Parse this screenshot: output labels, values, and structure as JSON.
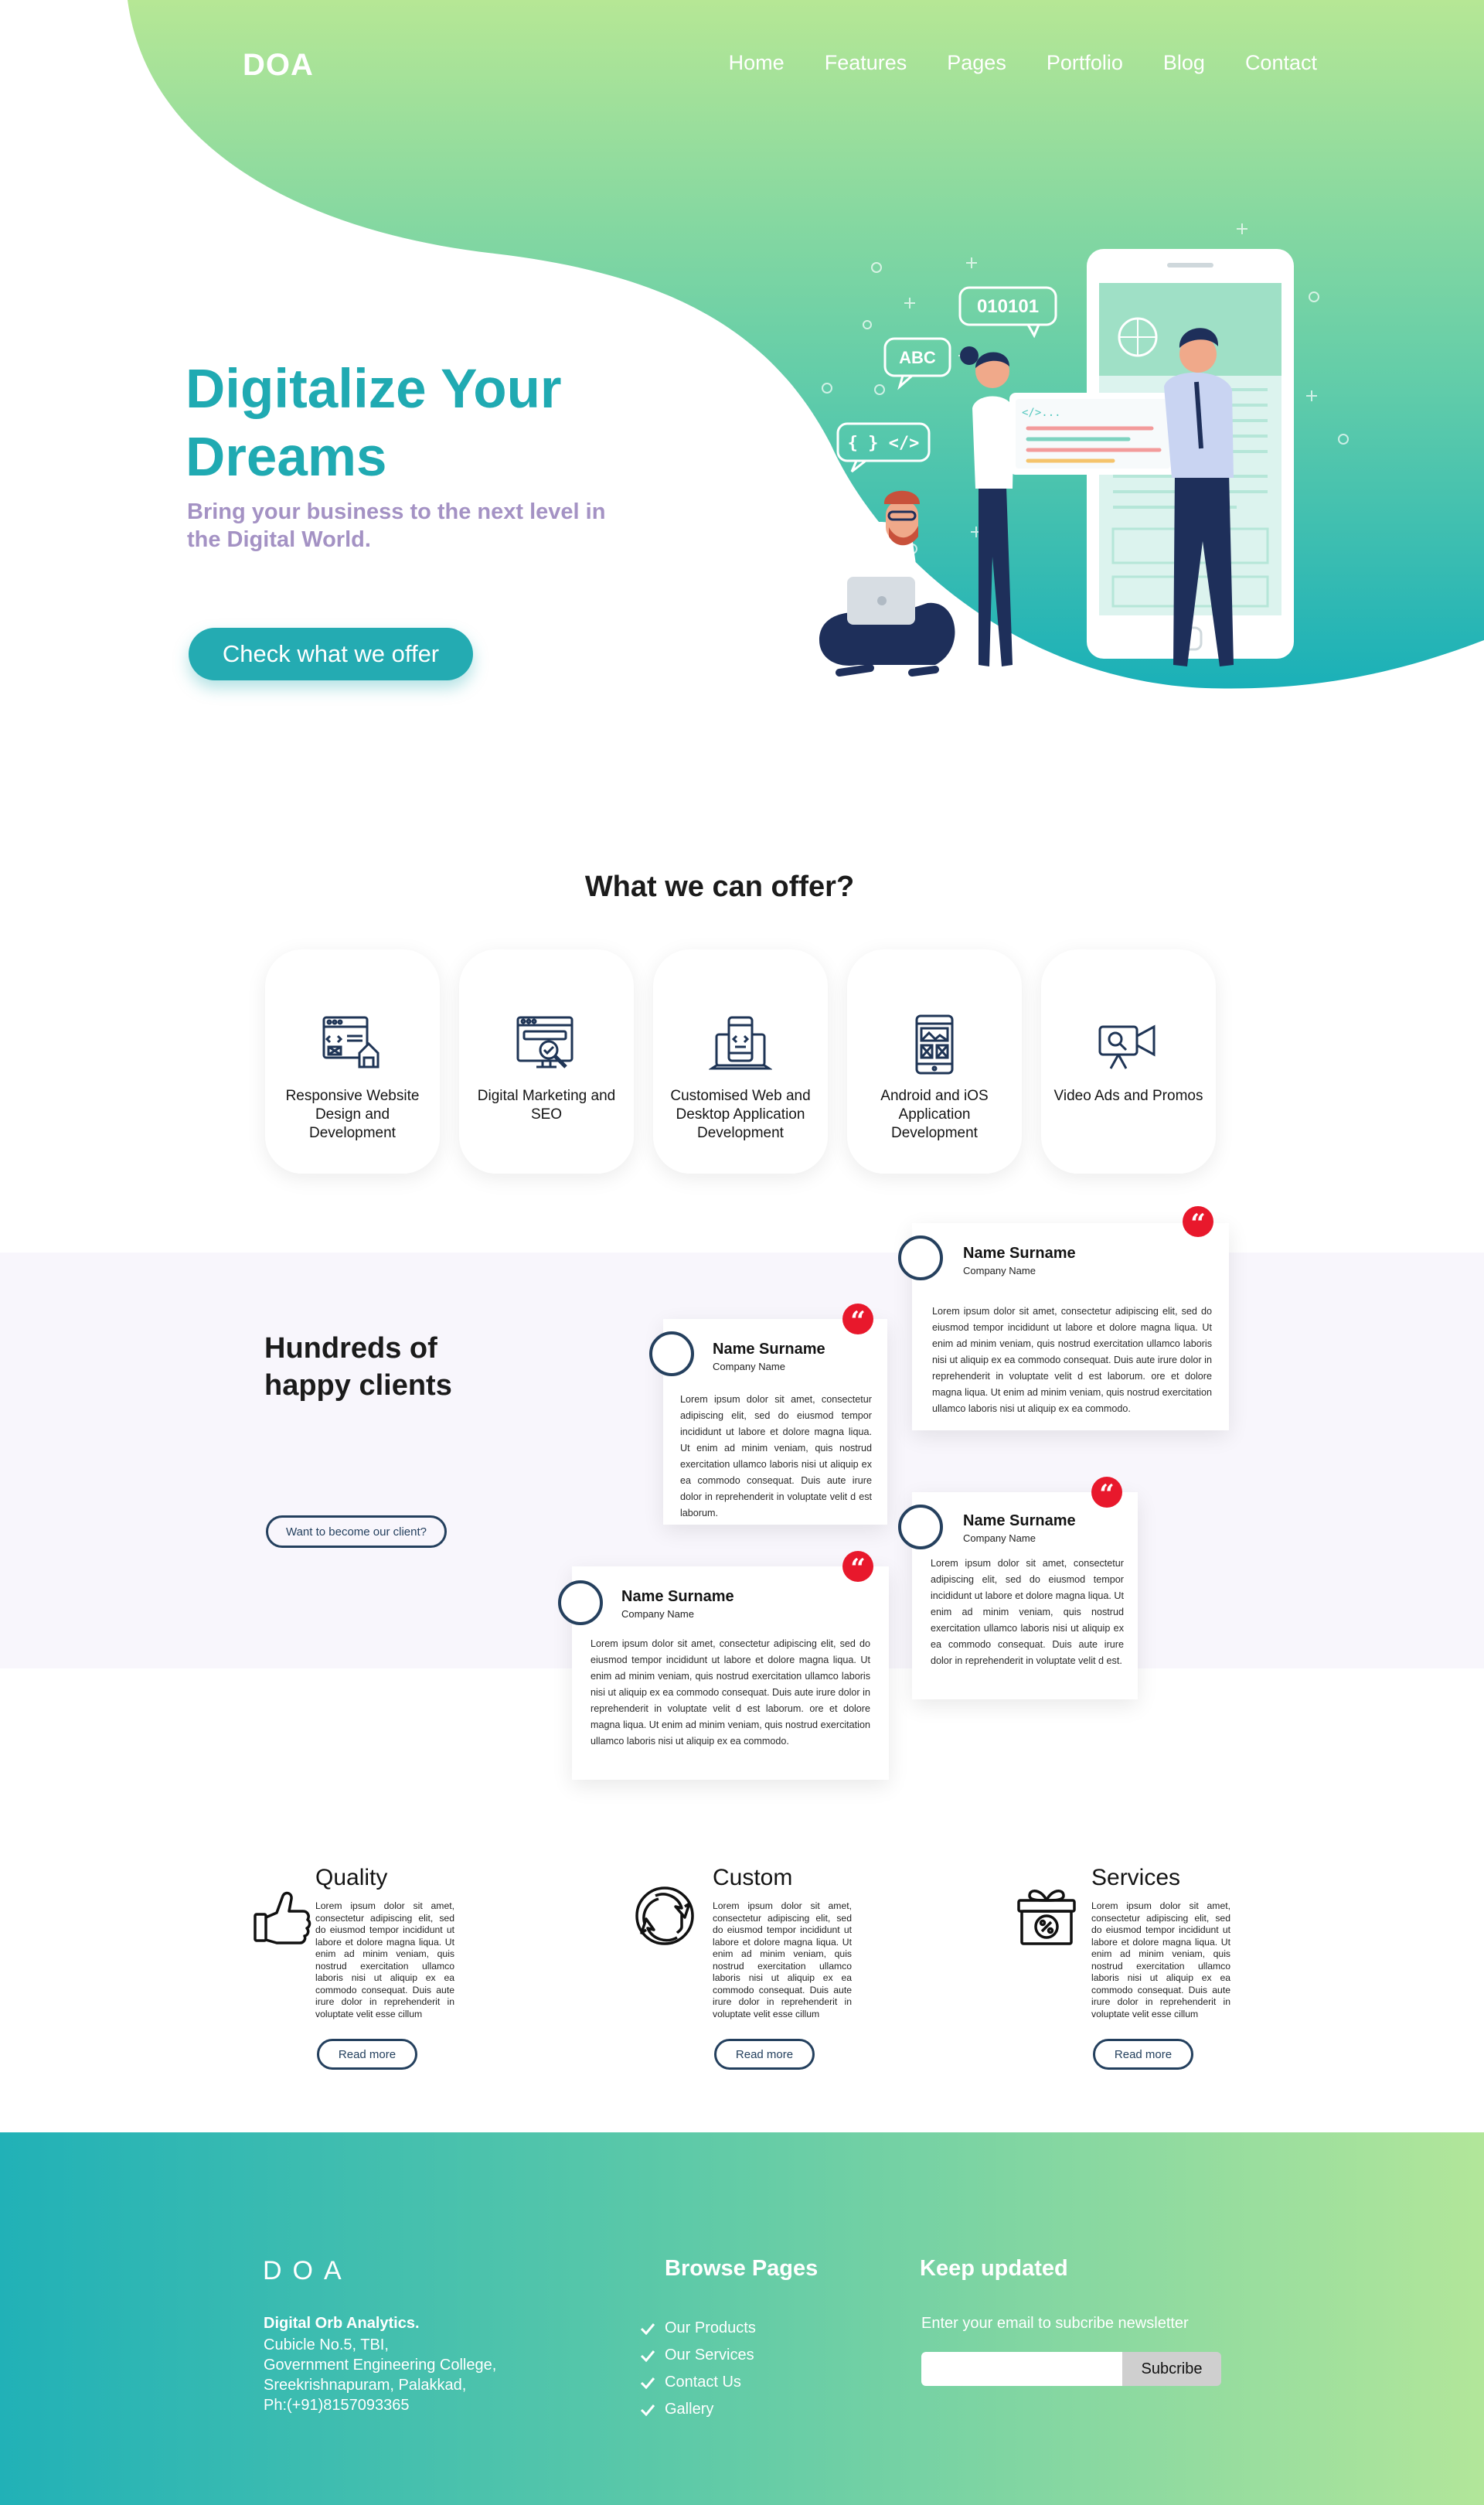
{
  "nav": {
    "logo": "DOA",
    "links": [
      "Home",
      "Features",
      "Pages",
      "Portfolio",
      "Blog",
      "Contact"
    ]
  },
  "hero": {
    "title": "Digitalize Your Dreams",
    "subtitle": "Bring your business to the next level in the Digital World.",
    "cta": "Check what we offer",
    "illustration": {
      "badges": [
        "010101",
        "ABC",
        "{ } </>"
      ]
    }
  },
  "offer": {
    "title": "What we can offer?",
    "services": [
      {
        "label": "Responsive Website Design and Development",
        "icon": "website-design-icon"
      },
      {
        "label": "Digital Marketing and SEO",
        "icon": "digital-marketing-icon"
      },
      {
        "label": "Customised Web and Desktop Application Development",
        "icon": "desktop-app-icon"
      },
      {
        "label": "Android and iOS Application Development",
        "icon": "mobile-app-icon"
      },
      {
        "label": "Video Ads and Promos",
        "icon": "video-camera-icon"
      }
    ]
  },
  "clients": {
    "title": "Hundreds of happy clients",
    "button": "Want to become our client?",
    "testimonials": [
      {
        "name": "Name Surname",
        "company": "Company Name",
        "text": "Lorem ipsum dolor sit amet, consectetur adipiscing elit, sed do eiusmod tempor incididunt ut labore et dolore magna liqua. Ut enim ad minim veniam, quis nostrud exercitation ullamco laboris nisi ut aliquip ex ea commodo consequat. Duis aute irure dolor in reprehenderit in voluptate velit d est laborum. ore et dolore magna liqua. Ut enim ad minim veniam, quis nostrud exercitation ullamco laboris nisi ut aliquip ex ea commodo."
      },
      {
        "name": "Name Surname",
        "company": "Company Name",
        "text": "Lorem ipsum dolor sit amet, consectetur adipiscing elit, sed do eiusmod tempor incididunt ut labore et dolore magna liqua. Ut enim ad minim veniam, quis nostrud exercitation ullamco laboris nisi ut aliquip ex ea commodo consequat. Duis aute irure dolor in reprehenderit in voluptate velit d est laborum."
      },
      {
        "name": "Name Surname",
        "company": "Company Name",
        "text": "Lorem ipsum dolor sit amet, consectetur adipiscing elit, sed do eiusmod tempor incididunt ut labore et dolore magna liqua. Ut enim ad minim veniam, quis nostrud exercitation ullamco laboris nisi ut aliquip ex ea commodo consequat. Duis aute irure dolor in reprehenderit in voluptate velit d est."
      },
      {
        "name": "Name Surname",
        "company": "Company Name",
        "text": "Lorem ipsum dolor sit amet, consectetur adipiscing elit, sed do eiusmod tempor incididunt ut labore et dolore magna liqua. Ut enim ad minim veniam, quis nostrud exercitation ullamco laboris nisi ut aliquip ex ea commodo consequat. Duis aute irure dolor in reprehenderit in voluptate velit d est laborum. ore et dolore magna liqua. Ut enim ad minim veniam, quis nostrud exercitation ullamco laboris nisi ut aliquip ex ea commodo."
      }
    ]
  },
  "features": [
    {
      "title": "Quality",
      "icon": "thumbs-up-icon",
      "text": "Lorem ipsum dolor sit amet, consectetur adipiscing elit, sed do eiusmod tempor incididunt ut labore et dolore magna liqua. Ut enim ad minim veniam, quis nostrud exercitation ullamco laboris nisi ut aliquip ex ea commodo consequat. Duis aute irure dolor in reprehenderit in voluptate velit esse cillum",
      "button": "Read more"
    },
    {
      "title": "Custom",
      "icon": "cycle-arrows-icon",
      "text": "Lorem ipsum dolor sit amet, consectetur adipiscing elit, sed do eiusmod tempor incididunt ut labore et dolore magna liqua. Ut enim ad minim veniam, quis nostrud exercitation ullamco laboris nisi ut aliquip ex ea commodo consequat. Duis aute irure dolor in reprehenderit in voluptate velit esse cillum",
      "button": "Read more"
    },
    {
      "title": "Services",
      "icon": "gift-percent-icon",
      "text": "Lorem ipsum dolor sit amet, consectetur adipiscing elit, sed do eiusmod tempor incididunt ut labore et dolore magna liqua. Ut enim ad minim veniam, quis nostrud exercitation ullamco laboris nisi ut aliquip ex ea commodo consequat. Duis aute irure dolor in reprehenderit in voluptate velit esse cillum",
      "button": "Read more"
    }
  ],
  "footer": {
    "logo": "DOA",
    "company": "Digital Orb Analytics.",
    "address": [
      "Cubicle No.5, TBI,",
      "Government Engineering College,",
      "Sreekrishnapuram, Palakkad,",
      "Ph:(+91)8157093365"
    ],
    "browse_title": "Browse Pages",
    "browse_links": [
      "Our Products",
      "Our Services",
      "Contact Us",
      "Gallery"
    ],
    "updates_title": "Keep updated",
    "updates_text": "Enter your email to subcribe newsletter",
    "email_placeholder": "",
    "subscribe_label": "Subcribe"
  },
  "colors": {
    "teal": "#20aab2",
    "green": "#b2e69a",
    "lavender": "#a492c4",
    "navy": "#24405e",
    "quote_red": "#e8182c"
  }
}
